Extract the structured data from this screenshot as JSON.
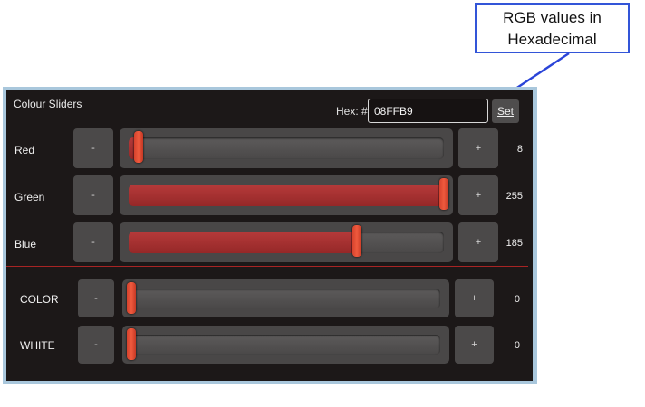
{
  "annotation": {
    "line1": "RGB values in",
    "line2": "Hexadecimal"
  },
  "panel": {
    "title": "Colour Sliders",
    "hex_label": "Hex: #",
    "hex_value": "08FFB9",
    "set_label": "Set"
  },
  "rows": [
    {
      "label": "Red",
      "minus": "-",
      "plus": "+",
      "value": "8",
      "fraction": 0.031,
      "filled": true
    },
    {
      "label": "Green",
      "minus": "-",
      "plus": "+",
      "value": "255",
      "fraction": 1.0,
      "filled": true
    },
    {
      "label": "Blue",
      "minus": "-",
      "plus": "+",
      "value": "185",
      "fraction": 0.725,
      "filled": true
    },
    {
      "label": "COLOR",
      "minus": "-",
      "plus": "+",
      "value": "0",
      "fraction": 0.0,
      "filled": false
    },
    {
      "label": "WHITE",
      "minus": "-",
      "plus": "+",
      "value": "0",
      "fraction": 0.0,
      "filled": false
    }
  ],
  "colors": {
    "accent": "#d6422c",
    "annotation_border": "#3355d8",
    "panel_border": "#a9c7dc"
  }
}
